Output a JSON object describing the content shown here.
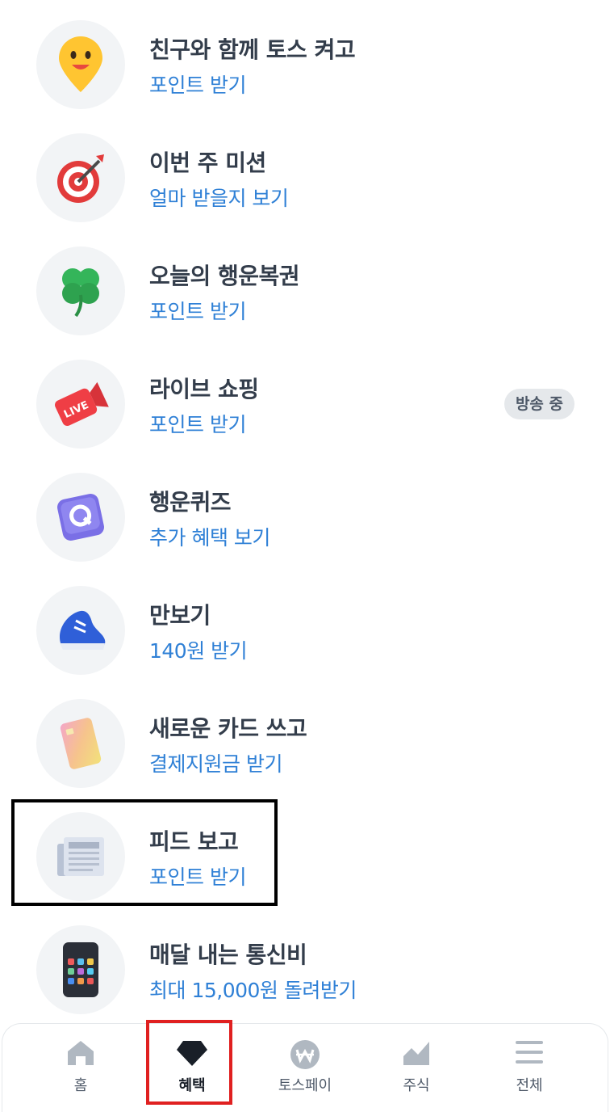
{
  "items": [
    {
      "title": "친구와 함께 토스 켜고",
      "subtitle": "포인트 받기",
      "icon": "yellow-pin-face-icon"
    },
    {
      "title": "이번 주 미션",
      "subtitle": "얼마 받을지 보기",
      "icon": "target-dart-icon"
    },
    {
      "title": "오늘의 행운복권",
      "subtitle": "포인트 받기",
      "icon": "four-leaf-clover-icon"
    },
    {
      "title": "라이브 쇼핑",
      "subtitle": "포인트 받기",
      "icon": "live-camera-icon",
      "badge": "방송 중"
    },
    {
      "title": "행운퀴즈",
      "subtitle": "추가 혜택 보기",
      "icon": "quiz-q-icon"
    },
    {
      "title": "만보기",
      "subtitle": "140원 받기",
      "icon": "sneaker-icon"
    },
    {
      "title": "새로운 카드 쓰고",
      "subtitle": "결제지원금 받기",
      "icon": "credit-card-icon"
    },
    {
      "title": "피드 보고",
      "subtitle": "포인트 받기",
      "icon": "newspaper-icon"
    },
    {
      "title": "매달 내는 통신비",
      "subtitle": "최대 15,000원 돌려받기",
      "icon": "smartphone-icon"
    }
  ],
  "tabs": [
    {
      "label": "홈",
      "icon": "home-icon"
    },
    {
      "label": "혜택",
      "icon": "diamond-icon",
      "active": true
    },
    {
      "label": "토스페이",
      "icon": "won-coin-icon"
    },
    {
      "label": "주식",
      "icon": "chart-icon"
    },
    {
      "label": "전체",
      "icon": "menu-icon"
    }
  ],
  "colors": {
    "title": "#333d4b",
    "subtitle": "#2f80d6",
    "badge_bg": "#e5e8eb"
  }
}
